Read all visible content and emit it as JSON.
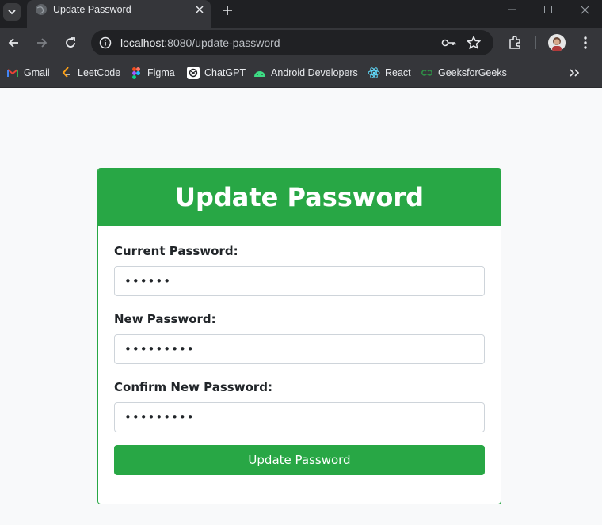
{
  "browser": {
    "tab_title": "Update Password",
    "url_host": "localhost",
    "url_rest": ":8080/update-password",
    "bookmarks": [
      {
        "label": "Gmail",
        "icon": "gmail-icon"
      },
      {
        "label": "LeetCode",
        "icon": "leetcode-icon"
      },
      {
        "label": "Figma",
        "icon": "figma-icon"
      },
      {
        "label": "ChatGPT",
        "icon": "chatgpt-icon"
      },
      {
        "label": "Android Developers",
        "icon": "android-icon"
      },
      {
        "label": "React",
        "icon": "react-icon"
      },
      {
        "label": "GeeksforGeeks",
        "icon": "geeksforgeeks-icon"
      }
    ]
  },
  "form": {
    "title": "Update Password",
    "current_label": "Current Password:",
    "current_value": "••••••",
    "new_label": "New Password:",
    "new_value": "•••••••••",
    "confirm_label": "Confirm New Password:",
    "confirm_value": "•••••••••",
    "submit_label": "Update Password"
  },
  "colors": {
    "accent": "#28a745",
    "chrome_dark": "#1f2023",
    "chrome": "#35363a",
    "page_bg": "#f8f9fa"
  }
}
